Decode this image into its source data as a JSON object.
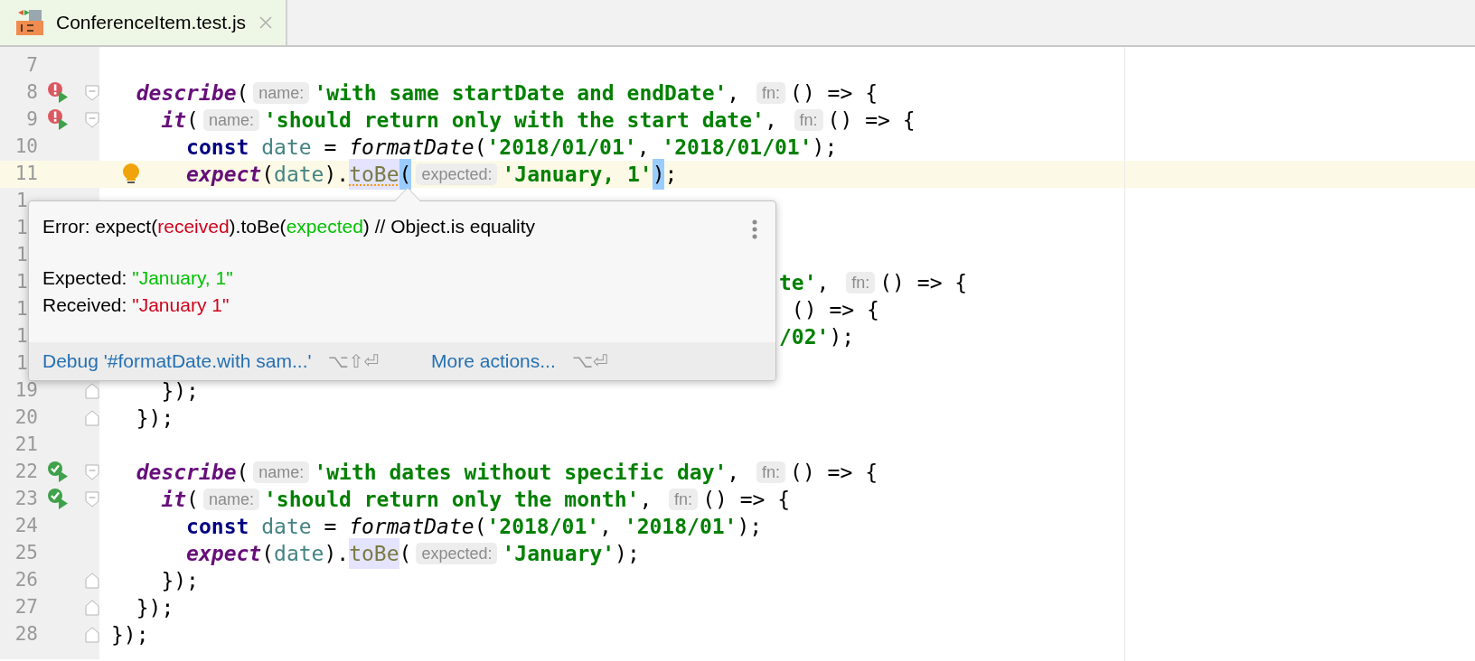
{
  "tab": {
    "title": "ConferenceItem.test.js",
    "selected": true
  },
  "editor": {
    "lines": [
      {
        "number": "7"
      },
      {
        "number": "8",
        "gutter": {
          "kind": "fail"
        },
        "fold": {
          "kind": "start"
        },
        "tokens": [
          {
            "text": "  describe",
            "kind": "fn"
          },
          {
            "text": "(",
            "kind": "plain"
          },
          {
            "text": "name:",
            "kind": "hint"
          },
          {
            "text": "'with same startDate and endDate'",
            "kind": "str"
          },
          {
            "text": ", ",
            "kind": "plain"
          },
          {
            "text": "fn:",
            "kind": "hint"
          },
          {
            "text": "() => {",
            "kind": "plain"
          }
        ]
      },
      {
        "number": "9",
        "gutter": {
          "kind": "fail"
        },
        "fold": {
          "kind": "start"
        },
        "tokens": [
          {
            "text": "    it",
            "kind": "fn"
          },
          {
            "text": "(",
            "kind": "plain"
          },
          {
            "text": "name:",
            "kind": "hint"
          },
          {
            "text": "'should return only with the start date'",
            "kind": "str"
          },
          {
            "text": ", ",
            "kind": "plain"
          },
          {
            "text": "fn:",
            "kind": "hint"
          },
          {
            "text": "() => {",
            "kind": "plain"
          }
        ]
      },
      {
        "number": "10",
        "tokens": [
          {
            "text": "      const ",
            "kind": "kw"
          },
          {
            "text": "date",
            "kind": "var"
          },
          {
            "text": " = ",
            "kind": "plain"
          },
          {
            "text": "formatDate",
            "kind": "call"
          },
          {
            "text": "(",
            "kind": "plain"
          },
          {
            "text": "'2018/01/01'",
            "kind": "str"
          },
          {
            "text": ", ",
            "kind": "plain"
          },
          {
            "text": "'2018/01/01'",
            "kind": "str"
          },
          {
            "text": ");",
            "kind": "plain"
          }
        ]
      },
      {
        "number": "11",
        "current": true,
        "gutter": {
          "kind": "bulb"
        },
        "tokens": [
          {
            "text": "      expect",
            "kind": "fn"
          },
          {
            "text": "(",
            "kind": "plain"
          },
          {
            "text": "date",
            "kind": "var"
          },
          {
            "text": ").",
            "kind": "plain"
          },
          {
            "text": "toBe",
            "kind": "method_error"
          },
          {
            "text": "(",
            "kind": "brace"
          },
          {
            "text": "expected:",
            "kind": "hint"
          },
          {
            "text": "'January, 1'",
            "kind": "str"
          },
          {
            "text": ")",
            "kind": "brace"
          },
          {
            "text": ";",
            "kind": "plain"
          }
        ]
      },
      {
        "number": "1",
        "number_covered": true
      },
      {
        "number": "1",
        "number_covered": true
      },
      {
        "number": "1",
        "number_covered": true
      },
      {
        "number": "1",
        "number_covered": true,
        "covered": true,
        "tokens": [
          {
            "text": "te'",
            "kind": "str"
          },
          {
            "text": ", ",
            "kind": "plain"
          },
          {
            "text": "fn:",
            "kind": "hint"
          },
          {
            "text": "() => {",
            "kind": "plain"
          }
        ]
      },
      {
        "number": "1",
        "number_covered": true,
        "covered": true,
        "tokens": [
          {
            "text": " () => {",
            "kind": "plain"
          }
        ]
      },
      {
        "number": "1",
        "number_covered": true,
        "covered": true,
        "tokens": [
          {
            "text": "/02'",
            "kind": "str"
          },
          {
            "text": ");",
            "kind": "plain"
          }
        ]
      },
      {
        "number": "1",
        "number_covered": true
      },
      {
        "number": "19",
        "fold": {
          "kind": "end"
        },
        "tokens": [
          {
            "text": "    });",
            "kind": "plain"
          }
        ]
      },
      {
        "number": "20",
        "fold": {
          "kind": "end"
        },
        "tokens": [
          {
            "text": "  });",
            "kind": "plain"
          }
        ]
      },
      {
        "number": "21"
      },
      {
        "number": "22",
        "gutter": {
          "kind": "pass"
        },
        "fold": {
          "kind": "start"
        },
        "tokens": [
          {
            "text": "  describe",
            "kind": "fn"
          },
          {
            "text": "(",
            "kind": "plain"
          },
          {
            "text": "name:",
            "kind": "hint"
          },
          {
            "text": "'with dates without specific day'",
            "kind": "str"
          },
          {
            "text": ", ",
            "kind": "plain"
          },
          {
            "text": "fn:",
            "kind": "hint"
          },
          {
            "text": "() => {",
            "kind": "plain"
          }
        ]
      },
      {
        "number": "23",
        "gutter": {
          "kind": "pass"
        },
        "fold": {
          "kind": "start"
        },
        "tokens": [
          {
            "text": "    it",
            "kind": "fn"
          },
          {
            "text": "(",
            "kind": "plain"
          },
          {
            "text": "name:",
            "kind": "hint"
          },
          {
            "text": "'should return only the month'",
            "kind": "str"
          },
          {
            "text": ", ",
            "kind": "plain"
          },
          {
            "text": "fn:",
            "kind": "hint"
          },
          {
            "text": "() => {",
            "kind": "plain"
          }
        ]
      },
      {
        "number": "24",
        "tokens": [
          {
            "text": "      const ",
            "kind": "kw"
          },
          {
            "text": "date",
            "kind": "var"
          },
          {
            "text": " = ",
            "kind": "plain"
          },
          {
            "text": "formatDate",
            "kind": "call"
          },
          {
            "text": "(",
            "kind": "plain"
          },
          {
            "text": "'2018/01'",
            "kind": "str"
          },
          {
            "text": ", ",
            "kind": "plain"
          },
          {
            "text": "'2018/01'",
            "kind": "str"
          },
          {
            "text": ");",
            "kind": "plain"
          }
        ]
      },
      {
        "number": "25",
        "tokens": [
          {
            "text": "      expect",
            "kind": "fn"
          },
          {
            "text": "(",
            "kind": "plain"
          },
          {
            "text": "date",
            "kind": "var"
          },
          {
            "text": ").",
            "kind": "plain"
          },
          {
            "text": "toBe",
            "kind": "method"
          },
          {
            "text": "(",
            "kind": "plain"
          },
          {
            "text": "expected:",
            "kind": "hint"
          },
          {
            "text": "'January'",
            "kind": "str"
          },
          {
            "text": ");",
            "kind": "plain"
          }
        ]
      },
      {
        "number": "26",
        "fold": {
          "kind": "end"
        },
        "tokens": [
          {
            "text": "    });",
            "kind": "plain"
          }
        ]
      },
      {
        "number": "27",
        "fold": {
          "kind": "end"
        },
        "tokens": [
          {
            "text": "  });",
            "kind": "plain"
          }
        ]
      },
      {
        "number": "28",
        "fold": {
          "kind": "end"
        },
        "tokens": [
          {
            "text": "});",
            "kind": "plain"
          }
        ]
      }
    ]
  },
  "popup": {
    "message": [
      {
        "text": "Error: expect(",
        "kind": "plain"
      },
      {
        "text": "received",
        "kind": "received"
      },
      {
        "text": ").toBe(",
        "kind": "plain"
      },
      {
        "text": "expected",
        "kind": "expected"
      },
      {
        "text": ") // Object.is equality",
        "kind": "plain"
      }
    ],
    "details": [
      [
        {
          "text": "Expected: ",
          "kind": "plain"
        },
        {
          "text": "\"January, 1\"",
          "kind": "expected"
        }
      ],
      [
        {
          "text": "Received: ",
          "kind": "plain"
        },
        {
          "text": "\"January 1\"",
          "kind": "received"
        }
      ]
    ],
    "actions": [
      {
        "label": "Debug '#formatDate.with sam...'",
        "shortcut": "⌥⇧⏎"
      },
      {
        "label": "More actions...",
        "shortcut": "⌥⏎"
      }
    ]
  }
}
